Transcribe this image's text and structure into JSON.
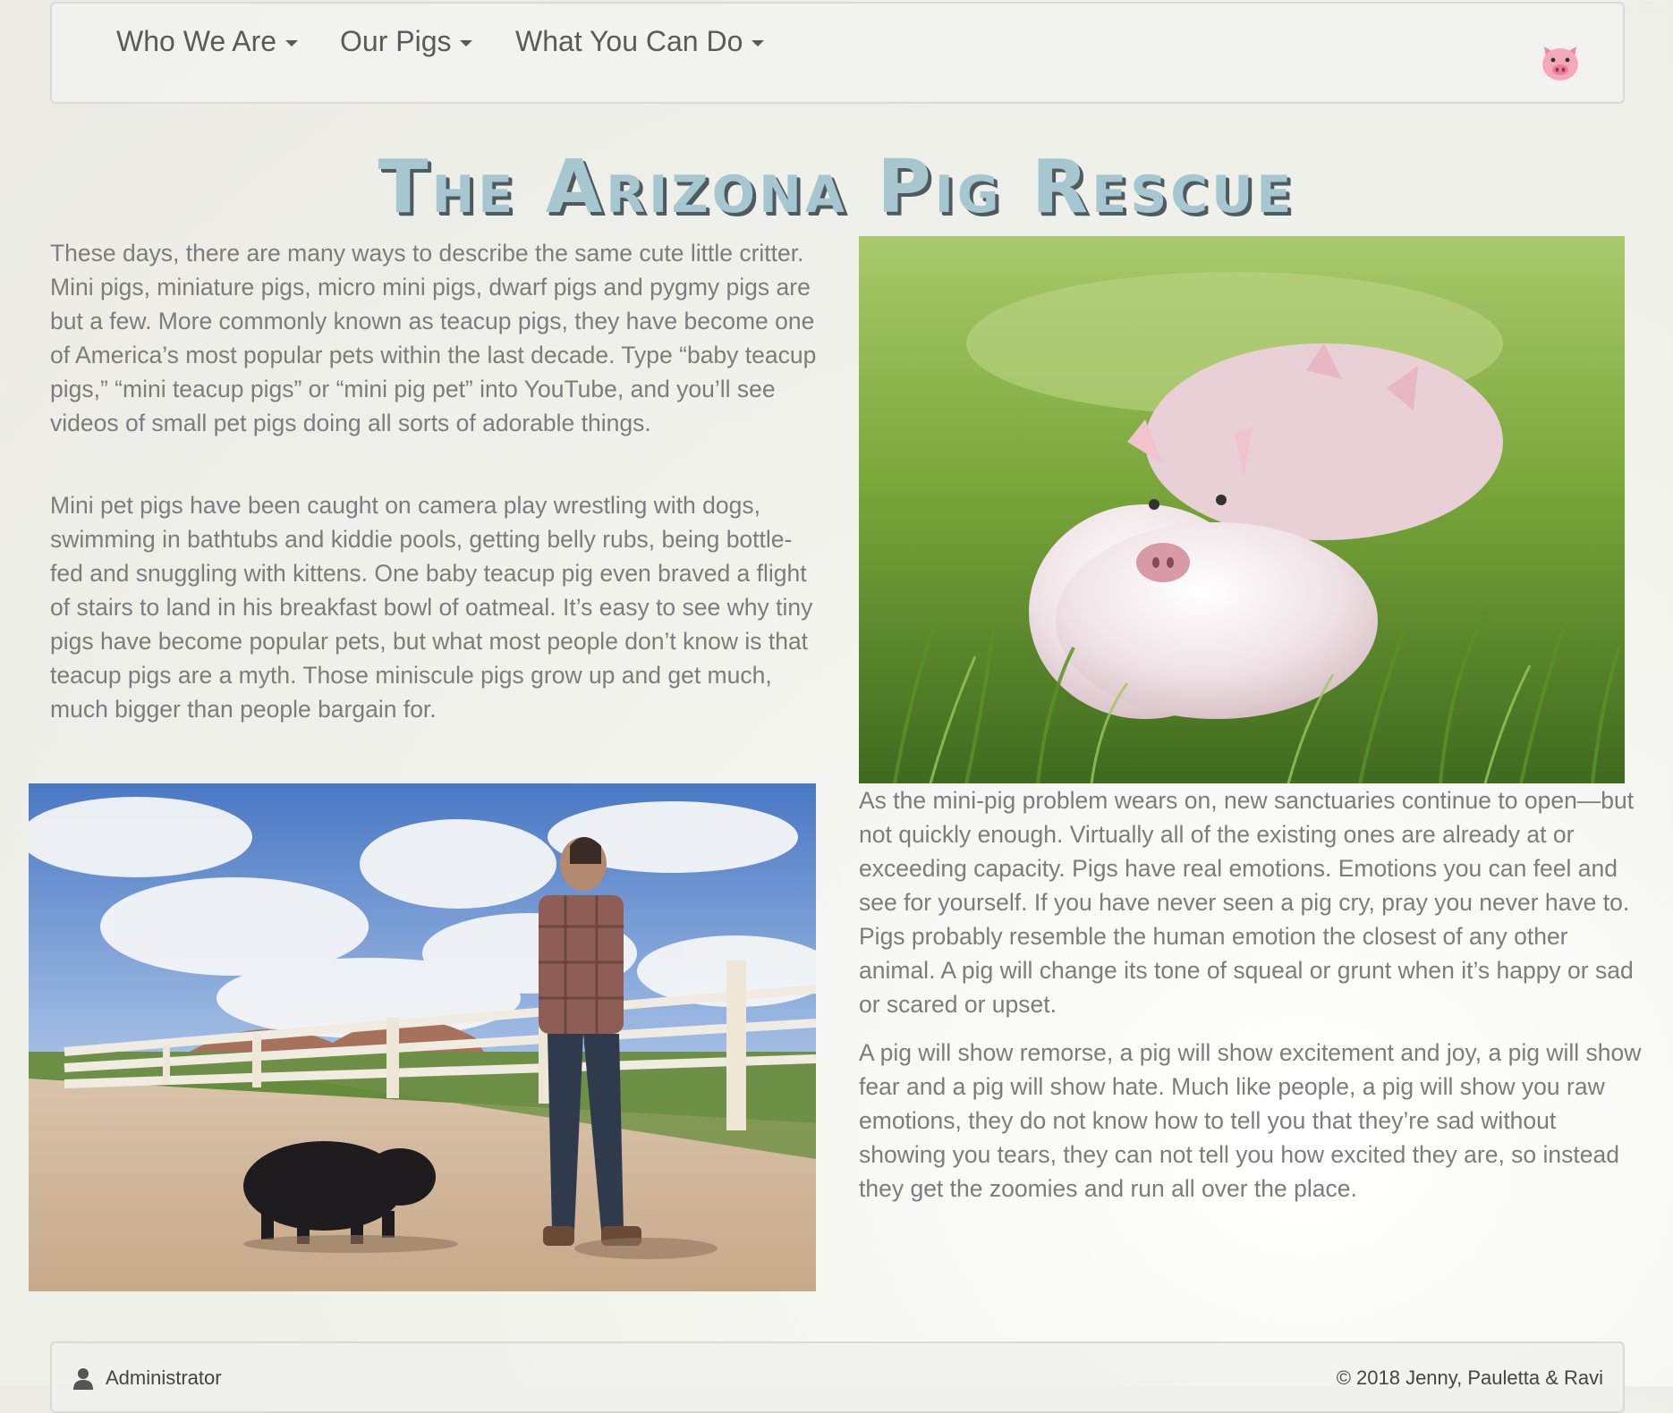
{
  "nav": {
    "items": [
      {
        "label": "Who We Are"
      },
      {
        "label": "Our Pigs"
      },
      {
        "label": "What You Can Do"
      }
    ],
    "logo_icon": "pig-face-icon"
  },
  "page": {
    "title": "The Arizona Pig Rescue",
    "paragraphs": [
      "These days, there are many ways to describe the same cute little critter. Mini pigs, miniature pigs, micro mini pigs, dwarf pigs and pygmy pigs are but a few. More commonly known as teacup pigs, they have become one of America’s most popular pets within the last decade. Type “baby teacup pigs,” “mini teacup pigs” or “mini pig pet” into YouTube, and you’ll see videos of small pet pigs doing all sorts of adorable things.",
      "Mini pet pigs have been caught on camera play wrestling with dogs, swimming in bathtubs and kiddie pools, getting belly rubs, being bottle-fed and snuggling with kittens. One baby teacup pig even braved a flight of stairs to land in his breakfast bowl of oatmeal. It’s easy to see why tiny pigs have become popular pets, but what most people don’t know is that teacup pigs are a myth. Those miniscule pigs grow up and get much, much bigger than people bargain for.",
      "As the mini-pig problem wears on, new sanctuaries continue to open—but not quickly enough. Virtually all of the existing ones are already at or exceeding capacity. Pigs have real emotions. Emotions you can feel and see for yourself. If you have never seen a pig cry, pray you never have to. Pigs probably resemble the human emotion the closest of any other animal. A pig will change its tone of squeal or grunt when it’s happy or sad or scared or upset.",
      "A pig will show remorse, a pig will show excitement and joy, a pig will show fear and a pig will show hate. Much like people, a pig will show you raw emotions, they do not know how to tell you that they’re sad without showing you tears, they can not tell you how excited they are, so instead they get the zoomies and run all over the place."
    ]
  },
  "footer": {
    "user_label": "Administrator",
    "copyright": "© 2018 Jenny, Pauletta & Ravi"
  },
  "colors": {
    "title_fill": "#a6c7d0",
    "title_shadow": "#4f5b60",
    "body_text": "#7c7c7c"
  }
}
